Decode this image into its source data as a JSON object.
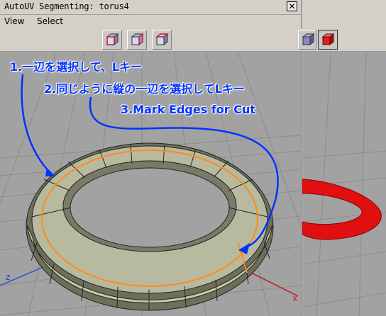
{
  "window": {
    "title": "AutoUV Segmenting: torus4",
    "close_label": "✕"
  },
  "menu": {
    "items": [
      "View",
      "Select"
    ]
  },
  "toolbar": {
    "buttons": [
      {
        "name": "view-cube-front-icon"
      },
      {
        "name": "view-cube-side-icon"
      },
      {
        "name": "view-cube-top-icon"
      },
      {
        "name": "view-cube-blue-icon"
      },
      {
        "name": "view-cube-red-icon"
      }
    ]
  },
  "annotations": {
    "step1": "1.一辺を選択して、Lキー",
    "step2": "2.同じように縦の一辺を選択してLキー",
    "step3": "3.Mark Edges for Cut"
  },
  "viewport": {
    "axis_label": "z",
    "axis_x_label": "x"
  },
  "colors": {
    "annotation": "#0033ff",
    "selected_edge": "#ff8c1a",
    "torus_face": "#c7c9a4",
    "torus_red": "#e01010",
    "viewport_bg": "#a2a2a2"
  }
}
